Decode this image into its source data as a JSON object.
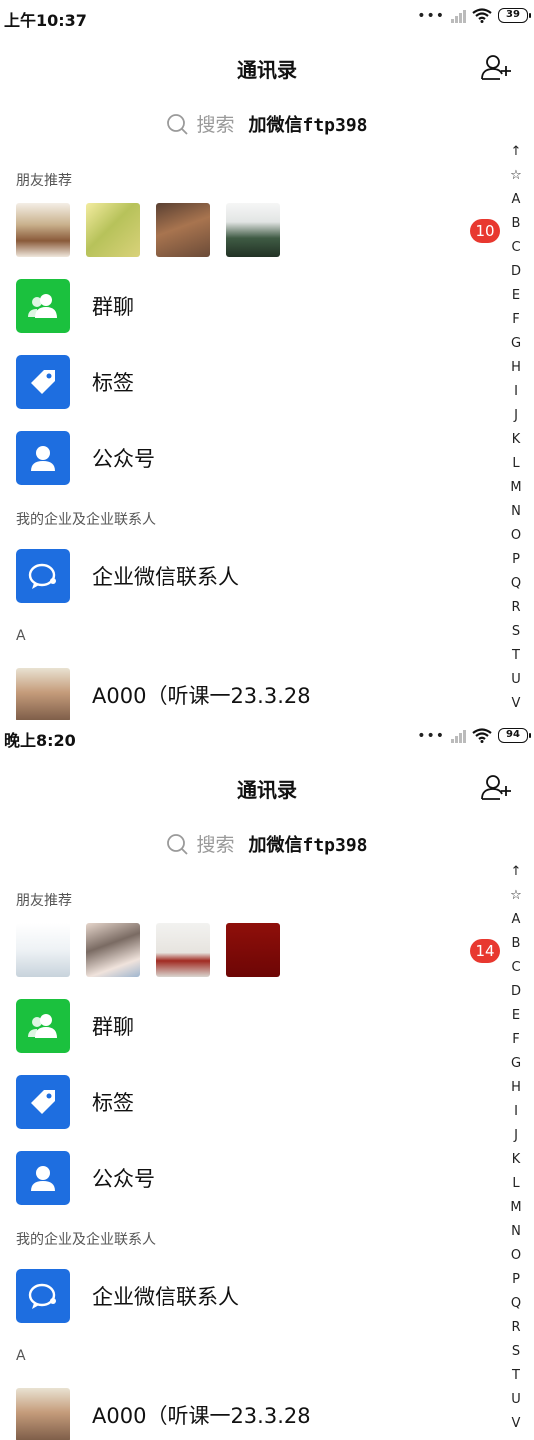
{
  "screens": [
    {
      "status_time": "上午10:37",
      "battery": "39",
      "title": "通讯录",
      "search_placeholder": "搜索",
      "search_promo": "加微信ftp398",
      "section_friends": "朋友推荐",
      "badge_count": "10",
      "menu": [
        "群聊",
        "标签",
        "公众号"
      ],
      "section_enterprise": "我的企业及企业联系人",
      "enterprise_item": "企业微信联系人",
      "section_a": "A",
      "contact_a": "A000（听课一23.3.28"
    },
    {
      "status_time": "晚上8:20",
      "battery": "94",
      "title": "通讯录",
      "search_placeholder": "搜索",
      "search_promo": "加微信ftp398",
      "section_friends": "朋友推荐",
      "badge_count": "14",
      "menu": [
        "群聊",
        "标签",
        "公众号"
      ],
      "section_enterprise": "我的企业及企业联系人",
      "enterprise_item": "企业微信联系人",
      "section_a": "A",
      "contact_a": "A000（听课一23.3.28"
    }
  ],
  "index_letters": [
    "↑",
    "☆",
    "A",
    "B",
    "C",
    "D",
    "E",
    "F",
    "G",
    "H",
    "I",
    "J",
    "K",
    "L",
    "M",
    "N",
    "O",
    "P",
    "Q",
    "R",
    "S",
    "T",
    "U",
    "V"
  ],
  "colors": {
    "accent_green": "#1bc13e",
    "accent_blue": "#1e6ee0",
    "badge_red": "#e8382f"
  },
  "icons": [
    "search-icon",
    "add-contact-icon",
    "group-chat-icon",
    "tag-icon",
    "official-account-icon",
    "enterprise-contact-icon",
    "wifi-icon",
    "battery-icon"
  ]
}
